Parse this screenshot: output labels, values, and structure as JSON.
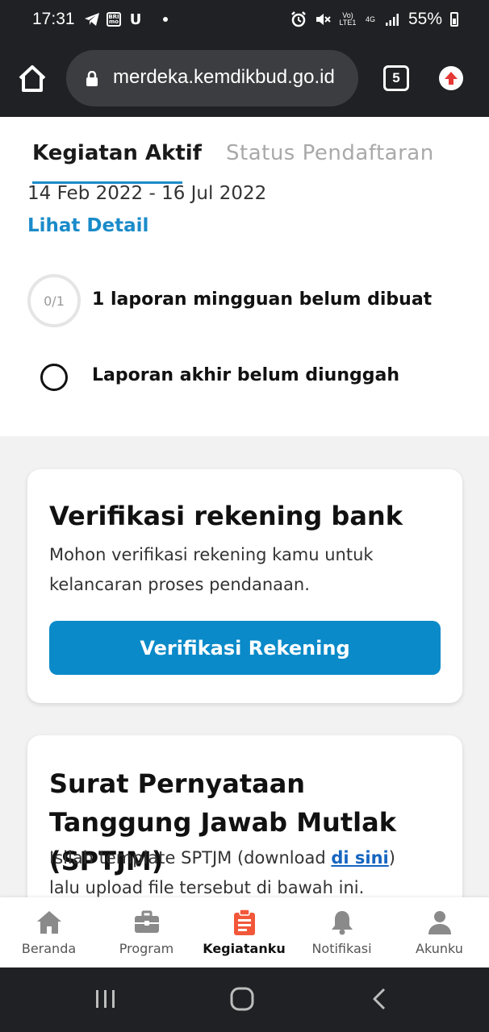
{
  "status_bar": {
    "time": "17:31",
    "left_icons": [
      "telegram-icon",
      "bri-mo-icon",
      "u-app-icon",
      "notification-dot"
    ],
    "bri_label": "BRI mo",
    "u_label": "U",
    "right_icons": [
      "alarm-icon",
      "mute-icon",
      "volte-icon",
      "4g-icon",
      "signal-icon"
    ],
    "volte_label": "Vo) LTE1",
    "network_label": "4G",
    "battery": "55%"
  },
  "browser": {
    "url": "merdeka.kemdikbud.go.id",
    "tab_count": "5"
  },
  "tabs": {
    "active": "Kegiatan Aktif",
    "inactive": "Status Pendaftaran"
  },
  "activity": {
    "date_range": "14 Feb 2022 - 16 Jul 2022",
    "detail_link": "Lihat Detail",
    "weekly_progress": "0/1",
    "weekly_report": "1 laporan mingguan belum dibuat",
    "final_report": "Laporan akhir belum diunggah"
  },
  "bank_card": {
    "title": "Verifikasi rekening bank",
    "description": "Mohon verifikasi rekening kamu untuk kelancaran proses pendanaan.",
    "button": "Verifikasi Rekening"
  },
  "sptjm_card": {
    "title": "Surat Pernyataan Tanggung Jawab Mutlak (SPTJM)",
    "desc_before": "Isilah template SPTJM (download ",
    "desc_link": "di sini",
    "desc_after": ") lalu upload file tersebut di bawah ini."
  },
  "bottom_nav": {
    "items": [
      {
        "label": "Beranda",
        "icon": "home-icon"
      },
      {
        "label": "Program",
        "icon": "briefcase-icon"
      },
      {
        "label": "Kegiatanku",
        "icon": "clipboard-icon"
      },
      {
        "label": "Notifikasi",
        "icon": "bell-icon"
      },
      {
        "label": "Akunku",
        "icon": "person-icon"
      }
    ],
    "active_index": 2
  },
  "colors": {
    "accent": "#0a8ac9",
    "link": "#1a8bc9",
    "active_nav_icon": "#f2573a",
    "inactive_nav_icon": "#8a8a8a"
  }
}
